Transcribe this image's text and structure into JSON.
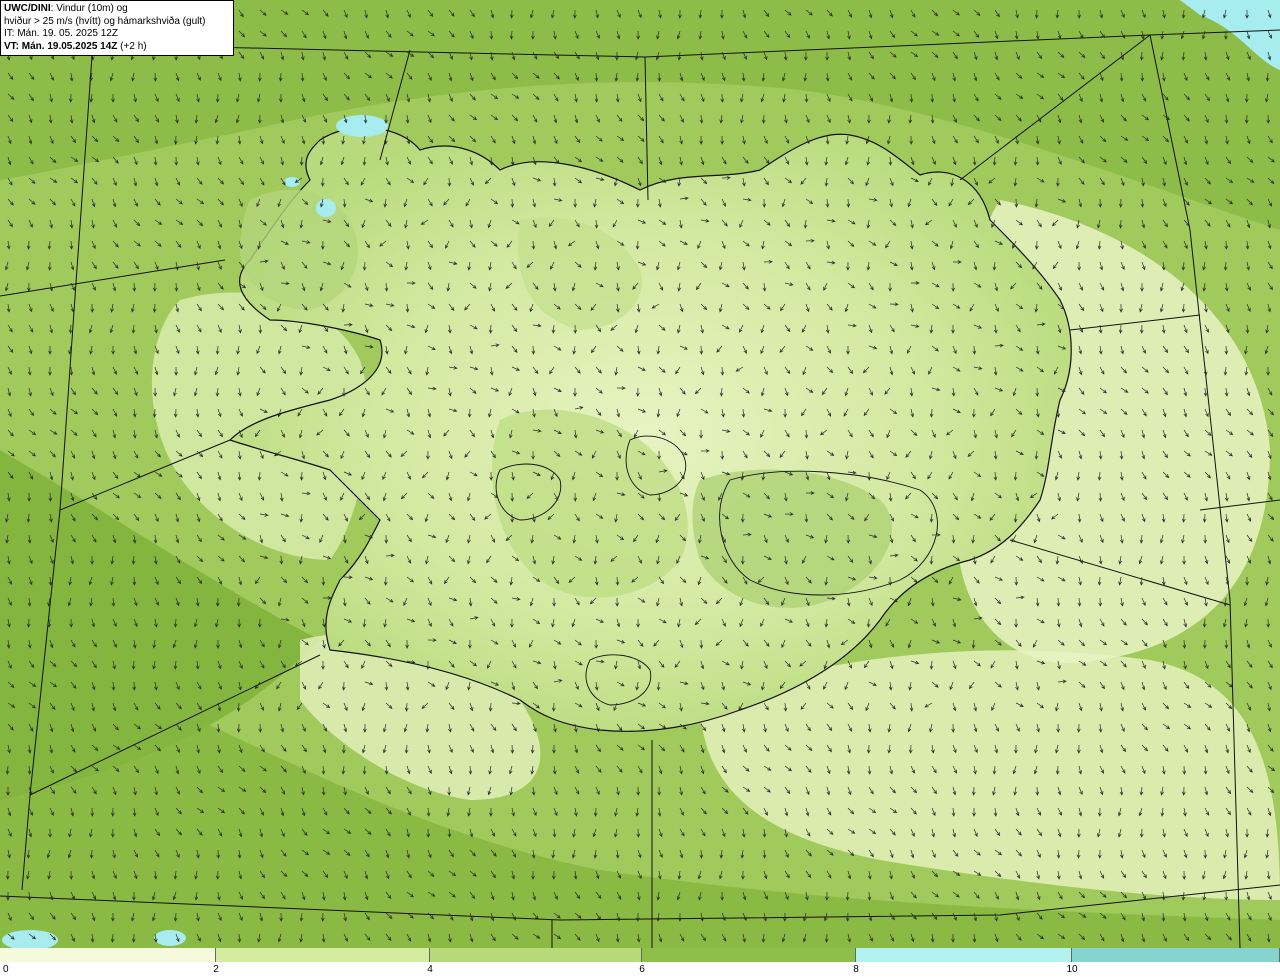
{
  "header": {
    "model": "UWC/DINI",
    "desc1": ": Vindur (10m) og",
    "desc2": "hviður > 25 m/s (hvítt) og hámarkshviða (gult)",
    "it": "IT: Mán. 19. 05. 2025 12Z",
    "vt_prefix": "VT: Mán. 19.05.2025 14Z",
    "vt_suffix": " (+2 h)"
  },
  "colorbar": {
    "ticks": [
      "0",
      "2",
      "4",
      "6",
      "8",
      "10"
    ],
    "colors": [
      "#f5fadc",
      "#d4eca0",
      "#b6d97a",
      "#8fbf4a",
      "#b2f3f2",
      "#86d4d0"
    ]
  },
  "map": {
    "sea_colors": [
      "#a8cf62",
      "#8fbf4a",
      "#7cb03a"
    ],
    "land_colors": [
      "#e8f3c2",
      "#c8e290",
      "#a9d068"
    ],
    "lake_color": "#a7ecef",
    "arrow_color": "#2a2a2a",
    "wind_direction": "north-northwest to southeast"
  }
}
